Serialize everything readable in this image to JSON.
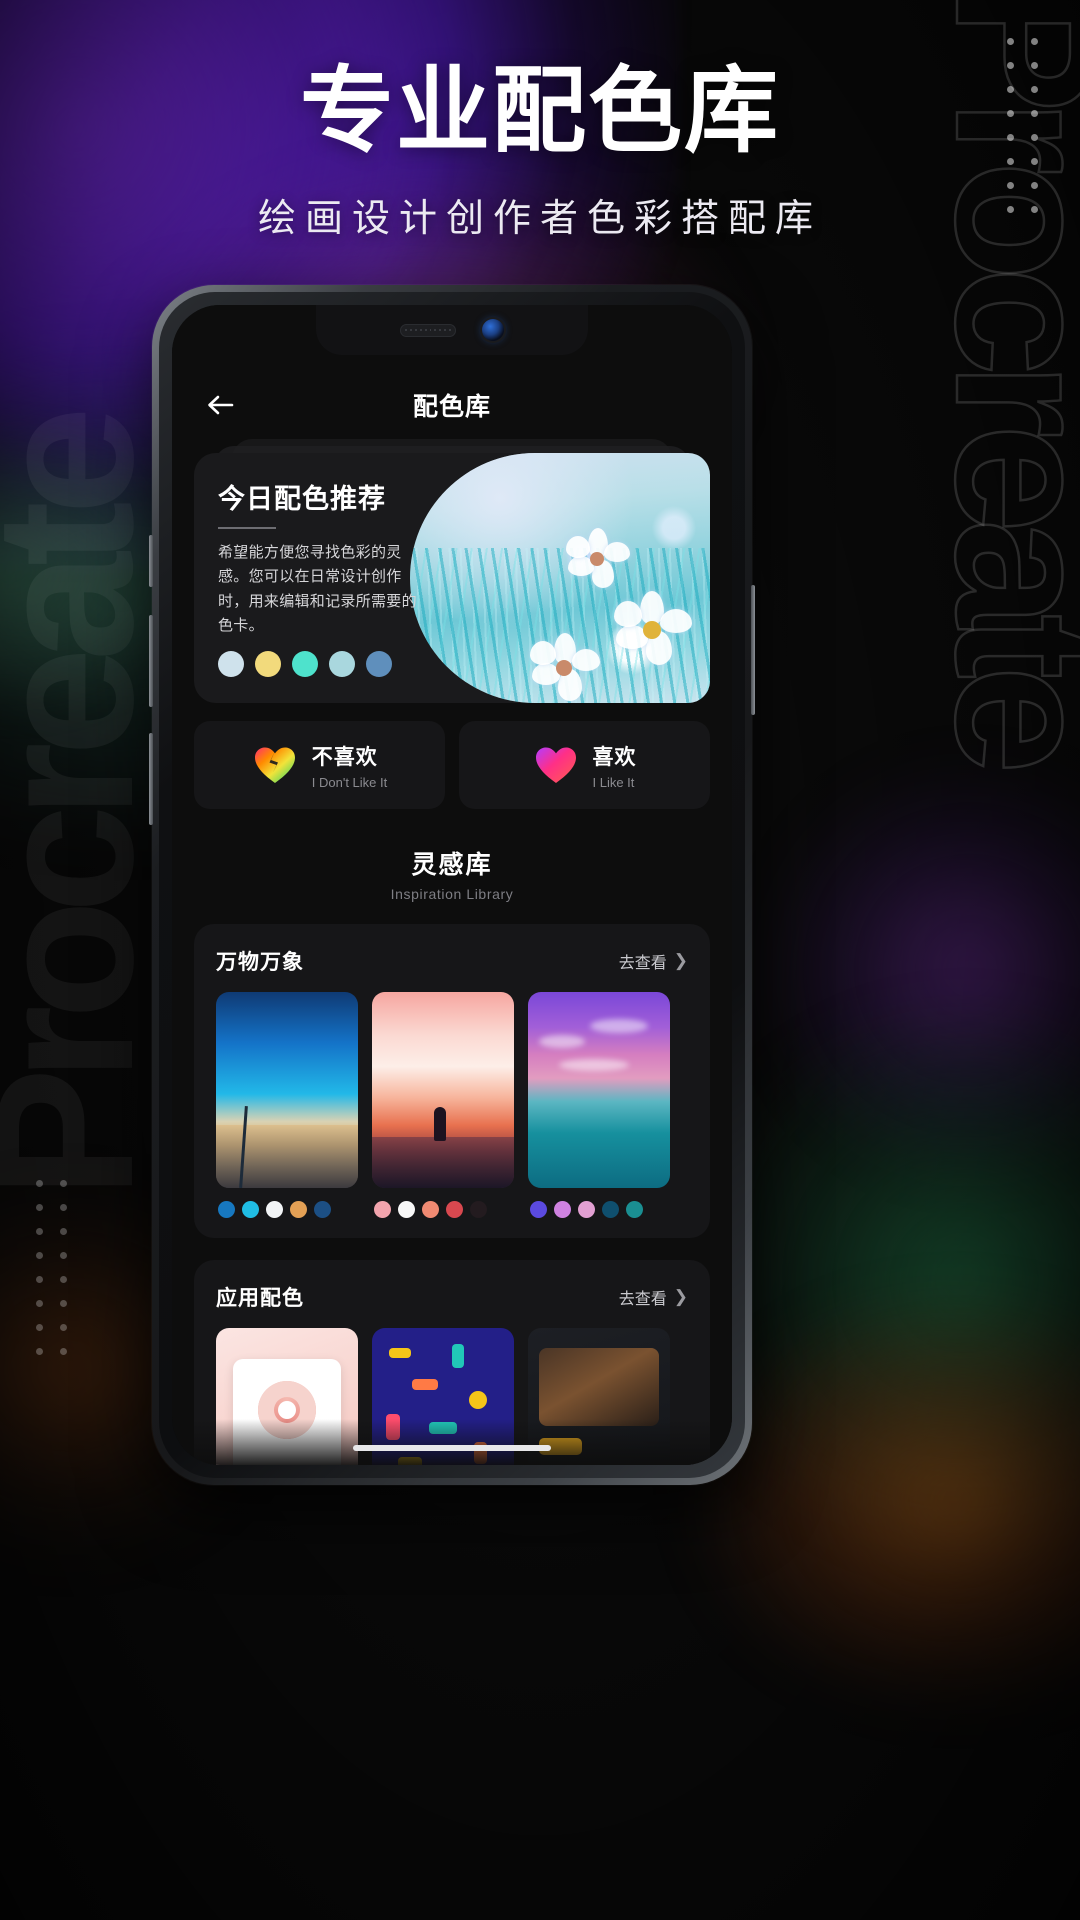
{
  "promo": {
    "title": "专业配色库",
    "subtitle": "绘画设计创作者色彩搭配库",
    "watermark_right": "Procreate",
    "watermark_left": "Procreate"
  },
  "app": {
    "header": {
      "back_icon": "arrow-left-icon",
      "title": "配色库"
    },
    "recommend_card": {
      "title": "今日配色推荐",
      "description": "希望能方便您寻找色彩的灵感。您可以在日常设计创作时，用来编辑和记录所需要的色卡。",
      "swatches": [
        "#cfe2ec",
        "#f2da7c",
        "#4ee2cc",
        "#a9d7de",
        "#5f8fbc"
      ]
    },
    "feedback": {
      "dislike": {
        "icon": "broken-heart-icon",
        "label_cn": "不喜欢",
        "label_en": "I Don't Like It"
      },
      "like": {
        "icon": "heart-icon",
        "label_cn": "喜欢",
        "label_en": "I Like It"
      }
    },
    "inspiration": {
      "title_cn": "灵感库",
      "title_en": "Inspiration Library"
    },
    "groups": [
      {
        "title": "万物万象",
        "more_label": "去查看",
        "more_icon": "chevron-right-icon",
        "items": [
          {
            "art": "beach",
            "dots": [
              "#1778c0",
              "#20bde4",
              "#f2f4f6",
              "#e3a055",
              "#1c4f84"
            ]
          },
          {
            "art": "sunset",
            "dots": [
              "#f2a4ad",
              "#f7f7f7",
              "#f08a72",
              "#d8484f",
              "#231b1f"
            ]
          },
          {
            "art": "tropic",
            "dots": [
              "#5b4ae0",
              "#cf82e0",
              "#e2a0d2",
              "#0f4f6e",
              "#1a8f92"
            ]
          }
        ]
      },
      {
        "title": "应用配色",
        "more_label": "去查看",
        "more_icon": "chevron-right-icon",
        "items": [
          {
            "art": "donut",
            "dots": []
          },
          {
            "art": "memphis",
            "dots": []
          },
          {
            "art": "darkapp",
            "dots": []
          }
        ]
      }
    ]
  },
  "colors": {
    "accent_purple": "#5a1fc0",
    "screen_bg": "#0d0d0d",
    "card_bg": "#1a1a1c",
    "panel_bg": "#161618"
  }
}
